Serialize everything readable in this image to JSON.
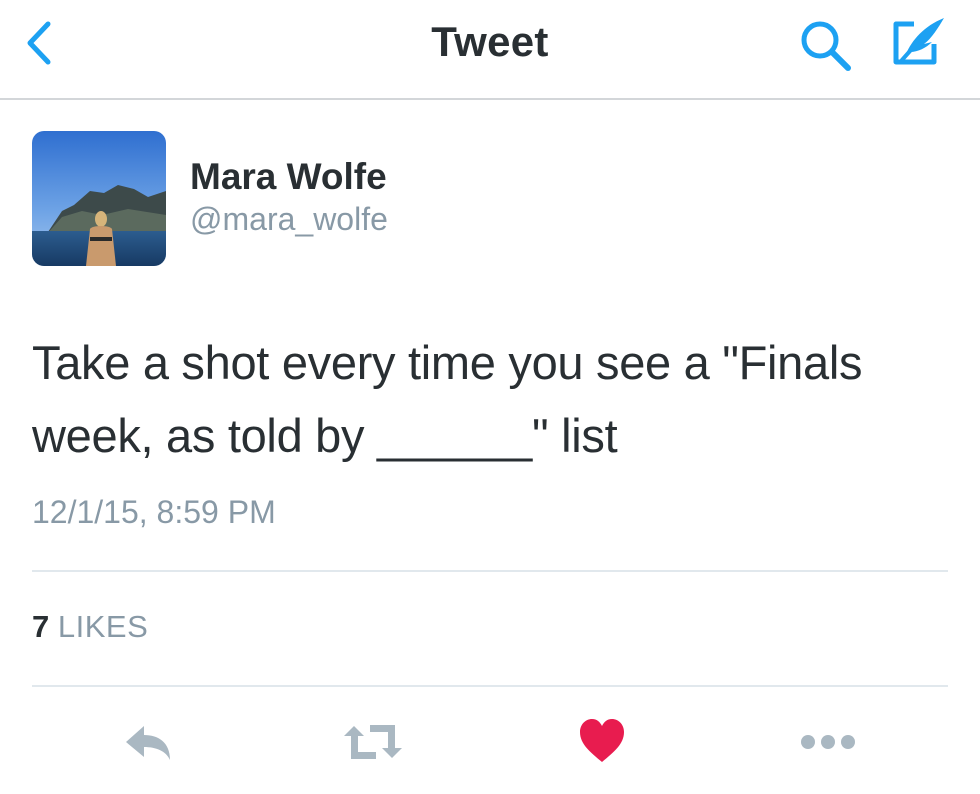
{
  "header": {
    "title": "Tweet",
    "back_icon": "chevron-left-icon",
    "search_icon": "search-icon",
    "compose_icon": "compose-tweet-icon",
    "accent_color": "#1da1f2"
  },
  "tweet": {
    "author_name": "Mara Wolfe",
    "author_handle": "@mara_wolfe",
    "text_line1": "Take a shot every time you see a \"Finals",
    "text_line2": "week, as told by ______\" list",
    "timestamp": "12/1/15, 8:59 PM",
    "likes_count": "7",
    "likes_label": "LIKES"
  },
  "actions": {
    "reply_icon": "reply-icon",
    "retweet_icon": "retweet-icon",
    "like_icon": "heart-icon",
    "more_icon": "more-dots-icon",
    "like_color": "#e81c4f",
    "icon_color": "#aab8c2"
  }
}
